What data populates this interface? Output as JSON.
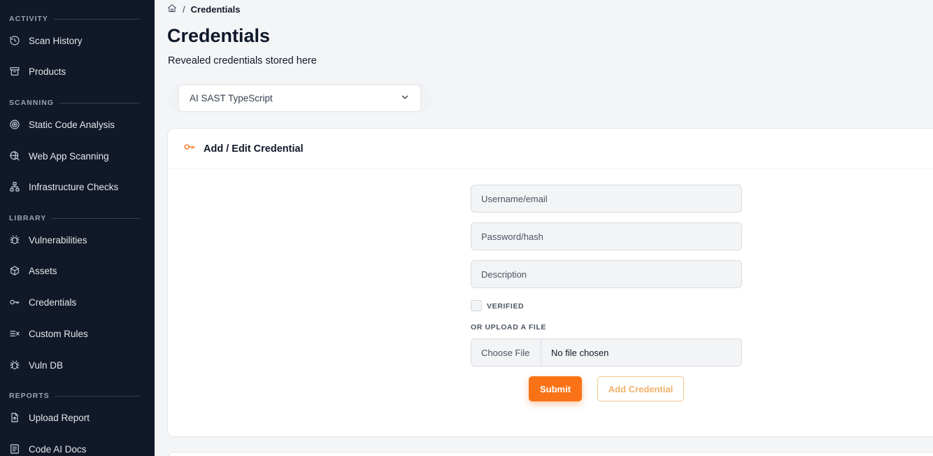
{
  "sidebar": {
    "sections": [
      {
        "label": "ACTIVITY"
      },
      {
        "label": "SCANNING"
      },
      {
        "label": "LIBRARY"
      },
      {
        "label": "REPORTS"
      }
    ],
    "items": [
      {
        "label": "Scan History",
        "icon": "history-icon"
      },
      {
        "label": "Products",
        "icon": "archive-icon"
      },
      {
        "label": "Static Code Analysis",
        "icon": "target-icon"
      },
      {
        "label": "Web App Scanning",
        "icon": "globe-search-icon"
      },
      {
        "label": "Infrastructure Checks",
        "icon": "network-icon"
      },
      {
        "label": "Vulnerabilities",
        "icon": "bug-icon"
      },
      {
        "label": "Assets",
        "icon": "cube-icon"
      },
      {
        "label": "Credentials",
        "icon": "key-icon"
      },
      {
        "label": "Custom Rules",
        "icon": "rules-icon"
      },
      {
        "label": "Vuln DB",
        "icon": "bug-icon"
      },
      {
        "label": "Upload Report",
        "icon": "file-upload-icon"
      },
      {
        "label": "Code AI Docs",
        "icon": "document-icon"
      }
    ]
  },
  "breadcrumb": {
    "current": "Credentials"
  },
  "page": {
    "title": "Credentials",
    "subtitle": "Revealed credentials stored here"
  },
  "product_select": {
    "value": "AI SAST TypeScript"
  },
  "form": {
    "header": "Add / Edit Credential",
    "username_placeholder": "Username/email",
    "password_placeholder": "Password/hash",
    "description_placeholder": "Description",
    "verified_label": "VERIFIED",
    "upload_label": "OR UPLOAD A FILE",
    "choose_file": "Choose File",
    "no_file": "No file chosen",
    "submit_label": "Submit",
    "add_label": "Add Credential"
  },
  "colors": {
    "sidebar_bg": "#111827",
    "accent": "#f97316",
    "page_bg": "#f4f5f7"
  }
}
